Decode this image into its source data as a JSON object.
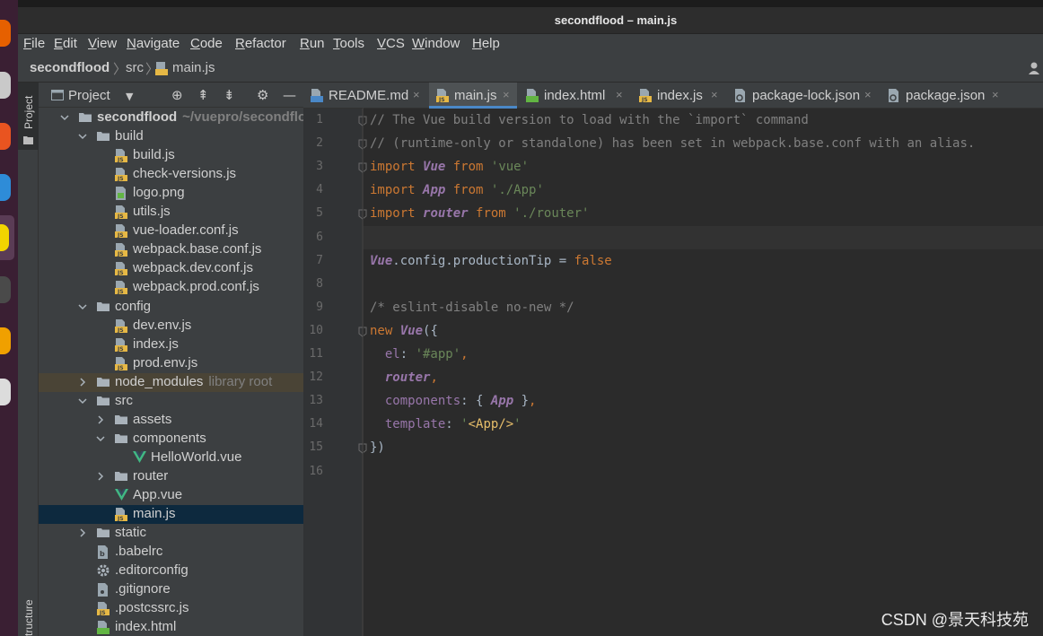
{
  "window": {
    "title": "secondflood – main.js"
  },
  "menu": [
    "File",
    "Edit",
    "View",
    "Navigate",
    "Code",
    "Refactor",
    "Run",
    "Tools",
    "VCS",
    "Window",
    "Help"
  ],
  "breadcrumb": {
    "project": "secondflood",
    "folder": "src",
    "file": "main.js"
  },
  "tool_stripe": {
    "project_label": "Project",
    "structure_label": "Structure"
  },
  "project_panel": {
    "title": "Project",
    "tree": [
      {
        "label": "secondflood",
        "note": "~/vuepro/secondflood",
        "icon": "folder-icon",
        "depth": 0,
        "arrow": "down",
        "bold": true
      },
      {
        "label": "build",
        "icon": "folder-icon",
        "depth": 1,
        "arrow": "down"
      },
      {
        "label": "build.js",
        "icon": "js-file-icon",
        "depth": 2
      },
      {
        "label": "check-versions.js",
        "icon": "js-file-icon",
        "depth": 2
      },
      {
        "label": "logo.png",
        "icon": "image-file-icon",
        "depth": 2
      },
      {
        "label": "utils.js",
        "icon": "js-file-icon",
        "depth": 2
      },
      {
        "label": "vue-loader.conf.js",
        "icon": "js-file-icon",
        "depth": 2
      },
      {
        "label": "webpack.base.conf.js",
        "icon": "js-file-icon",
        "depth": 2
      },
      {
        "label": "webpack.dev.conf.js",
        "icon": "js-file-icon",
        "depth": 2
      },
      {
        "label": "webpack.prod.conf.js",
        "icon": "js-file-icon",
        "depth": 2
      },
      {
        "label": "config",
        "icon": "folder-icon",
        "depth": 1,
        "arrow": "down"
      },
      {
        "label": "dev.env.js",
        "icon": "js-file-icon",
        "depth": 2
      },
      {
        "label": "index.js",
        "icon": "js-file-icon",
        "depth": 2
      },
      {
        "label": "prod.env.js",
        "icon": "js-file-icon",
        "depth": 2
      },
      {
        "label": "node_modules",
        "note": "library root",
        "icon": "folder-icon",
        "depth": 1,
        "arrow": "right",
        "lib": true
      },
      {
        "label": "src",
        "icon": "folder-icon",
        "depth": 1,
        "arrow": "down"
      },
      {
        "label": "assets",
        "icon": "folder-icon",
        "depth": 2,
        "arrow": "right"
      },
      {
        "label": "components",
        "icon": "folder-icon",
        "depth": 2,
        "arrow": "down"
      },
      {
        "label": "HelloWorld.vue",
        "icon": "vue-file-icon",
        "depth": 3
      },
      {
        "label": "router",
        "icon": "folder-icon",
        "depth": 2,
        "arrow": "right"
      },
      {
        "label": "App.vue",
        "icon": "vue-file-icon",
        "depth": 2
      },
      {
        "label": "main.js",
        "icon": "js-file-icon",
        "depth": 2,
        "selected": true
      },
      {
        "label": "static",
        "icon": "folder-icon",
        "depth": 1,
        "arrow": "right"
      },
      {
        "label": ".babelrc",
        "icon": "babel-file-icon",
        "depth": 1
      },
      {
        "label": ".editorconfig",
        "icon": "gear-file-icon",
        "depth": 1
      },
      {
        "label": ".gitignore",
        "icon": "git-file-icon",
        "depth": 1
      },
      {
        "label": ".postcssrc.js",
        "icon": "js-file-icon",
        "depth": 1
      },
      {
        "label": "index.html",
        "icon": "html-file-icon",
        "depth": 1
      }
    ]
  },
  "tabs": [
    {
      "label": "README.md",
      "icon": "md-file-icon",
      "active": false
    },
    {
      "label": "main.js",
      "icon": "js-file-icon",
      "active": true
    },
    {
      "label": "index.html",
      "icon": "html-file-icon",
      "active": false
    },
    {
      "label": "index.js",
      "icon": "js-file-icon",
      "active": false
    },
    {
      "label": "package-lock.json",
      "icon": "json-file-icon",
      "active": false
    },
    {
      "label": "package.json",
      "icon": "json-file-icon",
      "active": false
    }
  ],
  "editor": {
    "current_line": 6,
    "lines": [
      [
        {
          "t": "// The Vue build version to load with the `import` command",
          "c": "com"
        }
      ],
      [
        {
          "t": "// (runtime-only or standalone) has been set in webpack.base.conf with an alias.",
          "c": "com"
        }
      ],
      [
        {
          "t": "import ",
          "c": "kw"
        },
        {
          "t": "Vue",
          "c": "cls"
        },
        {
          "t": " from ",
          "c": "kw"
        },
        {
          "t": "'vue'",
          "c": "str"
        }
      ],
      [
        {
          "t": "import ",
          "c": "kw"
        },
        {
          "t": "App",
          "c": "cls"
        },
        {
          "t": " from ",
          "c": "kw"
        },
        {
          "t": "'./App'",
          "c": "str"
        }
      ],
      [
        {
          "t": "import ",
          "c": "kw"
        },
        {
          "t": "router",
          "c": "cls"
        },
        {
          "t": " from ",
          "c": "kw"
        },
        {
          "t": "'./router'",
          "c": "str"
        }
      ],
      [],
      [
        {
          "t": "Vue",
          "c": "cls"
        },
        {
          "t": ".config.productionTip = ",
          "c": ""
        },
        {
          "t": "false",
          "c": "kw"
        }
      ],
      [],
      [
        {
          "t": "/* eslint-disable no-new */",
          "c": "com"
        }
      ],
      [
        {
          "t": "new ",
          "c": "kw"
        },
        {
          "t": "Vue",
          "c": "cls"
        },
        {
          "t": "({",
          "c": ""
        }
      ],
      [
        {
          "t": "  el",
          "c": "prop"
        },
        {
          "t": ": ",
          "c": ""
        },
        {
          "t": "'#app'",
          "c": "str"
        },
        {
          "t": ",",
          "c": "kw"
        }
      ],
      [
        {
          "t": "  router",
          "c": "cls"
        },
        {
          "t": ",",
          "c": "kw"
        }
      ],
      [
        {
          "t": "  components",
          "c": "prop"
        },
        {
          "t": ": { ",
          "c": ""
        },
        {
          "t": "App",
          "c": "cls"
        },
        {
          "t": " }",
          "c": ""
        },
        {
          "t": ",",
          "c": "kw"
        }
      ],
      [
        {
          "t": "  template",
          "c": "prop"
        },
        {
          "t": ": ",
          "c": ""
        },
        {
          "t": "'",
          "c": "str"
        },
        {
          "t": "<App/>",
          "c": "tag"
        },
        {
          "t": "'",
          "c": "str"
        }
      ],
      [
        {
          "t": "})",
          "c": ""
        }
      ],
      []
    ],
    "fold_lines": [
      1,
      2,
      3,
      5,
      10,
      15
    ]
  },
  "watermark": "CSDN @景天科技苑"
}
